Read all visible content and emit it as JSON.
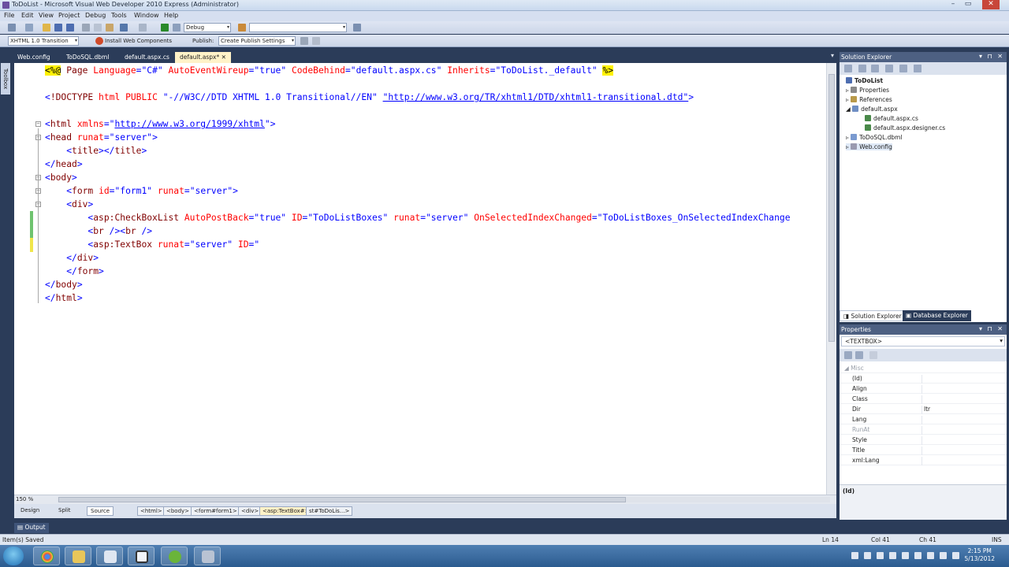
{
  "window": {
    "title": "ToDoList - Microsoft Visual Web Developer 2010 Express (Administrator)"
  },
  "menu": [
    "File",
    "Edit",
    "View",
    "Project",
    "Debug",
    "Tools",
    "Window",
    "Help"
  ],
  "toolbar": {
    "config_value": "Debug",
    "target_value": "",
    "doctype_value": "XHTML 1.0 Transition",
    "install_label": "Install Web Components",
    "publish_label": "Publish:",
    "publish_value": "Create Publish Settings"
  },
  "toolbox_label": "Toolbox",
  "tabs": [
    "Web.config",
    "ToDoSQL.dbml",
    "default.aspx.cs",
    "default.aspx*"
  ],
  "code_lines": [
    "<%@ Page Language=\"C#\" AutoEventWireup=\"true\" CodeBehind=\"default.aspx.cs\" Inherits=\"ToDoList._default\" %>",
    "",
    "<!DOCTYPE html PUBLIC \"-//W3C//DTD XHTML 1.0 Transitional//EN\" \"http://www.w3.org/TR/xhtml1/DTD/xhtml1-transitional.dtd\">",
    "",
    "<html xmlns=\"http://www.w3.org/1999/xhtml\">",
    "<head runat=\"server\">",
    "    <title></title>",
    "</head>",
    "<body>",
    "    <form id=\"form1\" runat=\"server\">",
    "    <div>",
    "        <asp:CheckBoxList AutoPostBack=\"true\" ID=\"ToDoListBoxes\" runat=\"server\" OnSelectedIndexChanged=\"ToDoListBoxes_OnSelectedIndexChange",
    "        <br /><br />",
    "        <asp:TextBox runat=\"server\" ID=\"",
    "    </div>",
    "    </form>",
    "</body>",
    "</html>"
  ],
  "editor_bottom": {
    "zoom": "150 %",
    "views": [
      "Design",
      "Split",
      "Source"
    ],
    "breadcrumbs": [
      "<html>",
      "<body>",
      "<form#form1>",
      "<div>",
      "<asp:TextBox#>",
      "st#ToDoLis...>"
    ]
  },
  "solution_explorer": {
    "title": "Solution Explorer",
    "items": [
      {
        "label": "ToDoList",
        "level": 0,
        "bold": true
      },
      {
        "label": "Properties",
        "level": 1
      },
      {
        "label": "References",
        "level": 1
      },
      {
        "label": "default.aspx",
        "level": 1
      },
      {
        "label": "default.aspx.cs",
        "level": 2
      },
      {
        "label": "default.aspx.designer.cs",
        "level": 2
      },
      {
        "label": "ToDoSQL.dbml",
        "level": 1
      },
      {
        "label": "Web.config",
        "level": 1
      }
    ],
    "bottom_tabs": [
      "Solution Explorer",
      "Database Explorer"
    ]
  },
  "properties": {
    "title": "Properties",
    "object": "<TEXTBOX>",
    "category": "Misc",
    "rows": [
      {
        "name": "(Id)",
        "value": ""
      },
      {
        "name": "Align",
        "value": ""
      },
      {
        "name": "Class",
        "value": ""
      },
      {
        "name": "Dir",
        "value": "ltr"
      },
      {
        "name": "Lang",
        "value": ""
      },
      {
        "name": "RunAt",
        "value": "",
        "dim": true
      },
      {
        "name": "Style",
        "value": ""
      },
      {
        "name": "Title",
        "value": ""
      },
      {
        "name": "xml:Lang",
        "value": ""
      }
    ],
    "description_title": "(Id)"
  },
  "output_tab": "Output",
  "status": {
    "message": "Item(s) Saved",
    "ln": "Ln 14",
    "col": "Col 41",
    "ch": "Ch 41",
    "mode": "INS"
  },
  "clock": {
    "time": "2:15 PM",
    "date": "5/13/2012"
  },
  "colors": {
    "tag": "#800000",
    "attr": "#ff0000",
    "value": "#0000ff",
    "panel_header": "#4d6082",
    "chrome": "#2b3c59"
  }
}
